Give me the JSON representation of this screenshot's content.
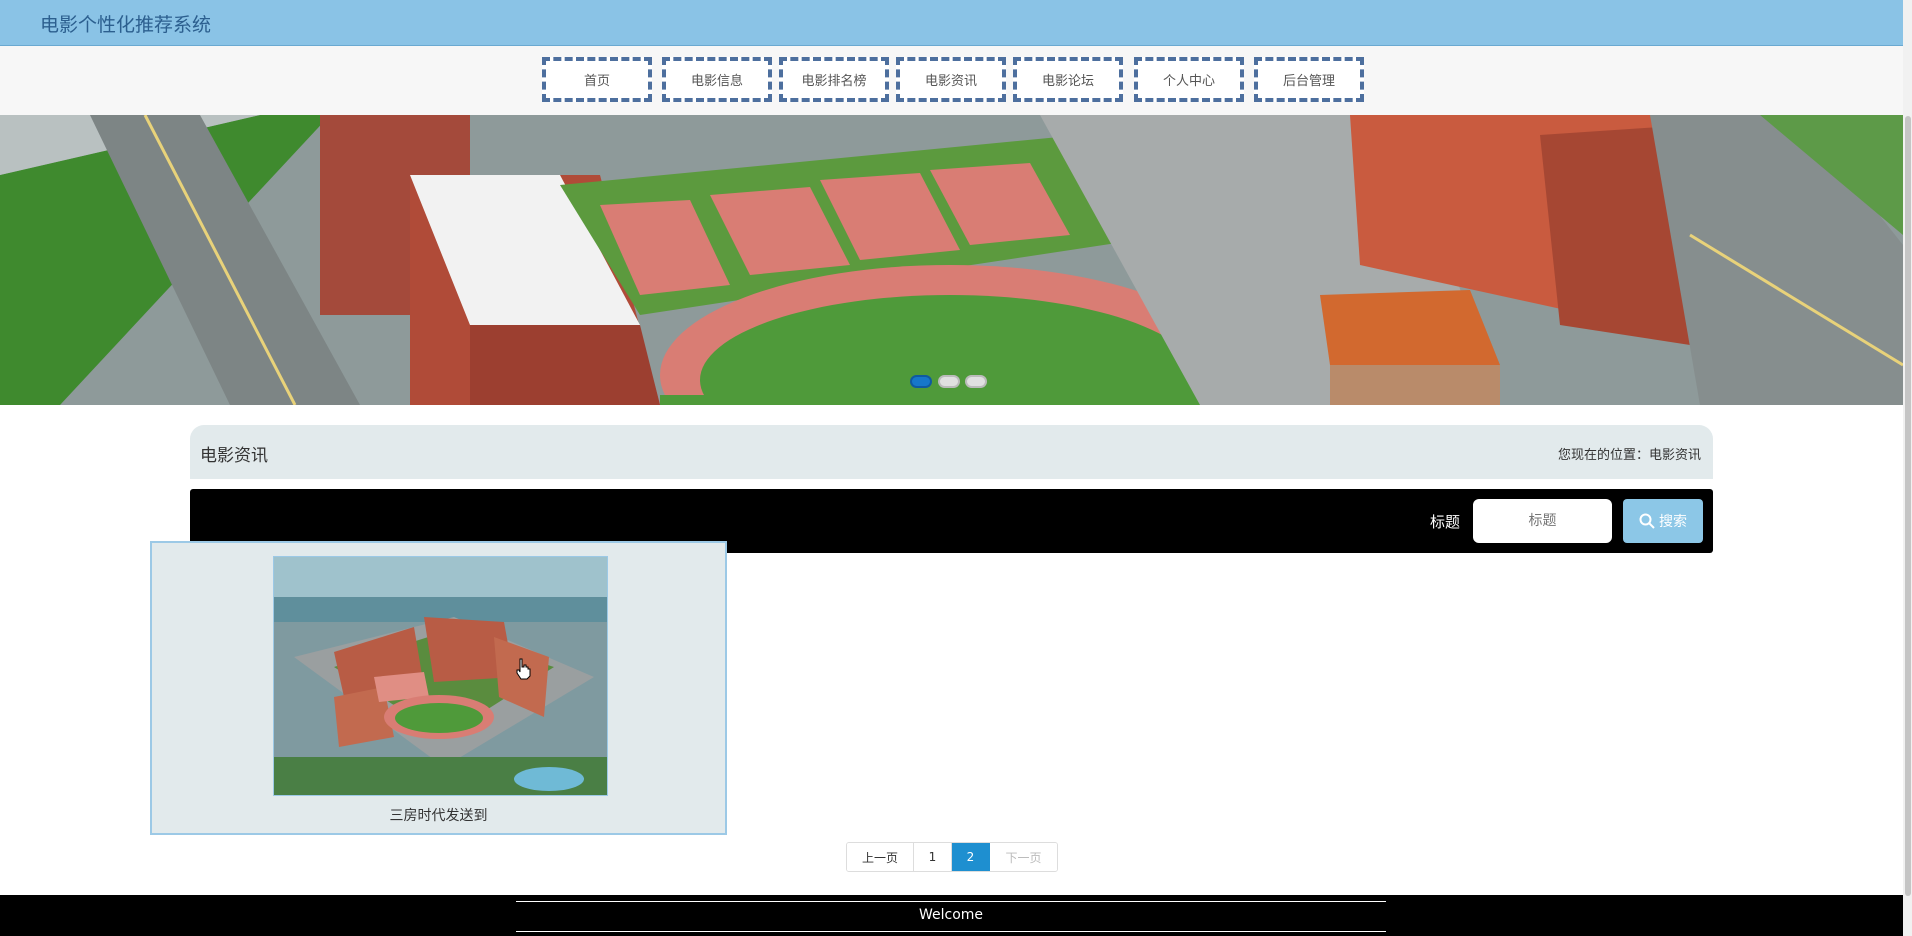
{
  "header": {
    "site_title": "电影个性化推荐系统"
  },
  "nav": {
    "items": [
      {
        "label": "首页"
      },
      {
        "label": "电影信息"
      },
      {
        "label": "电影排名榜"
      },
      {
        "label": "电影资讯"
      },
      {
        "label": "电影论坛"
      },
      {
        "label": "个人中心"
      },
      {
        "label": "后台管理"
      }
    ]
  },
  "banner": {
    "slide_count": 3,
    "active_slide": 1
  },
  "section": {
    "title": "电影资讯",
    "breadcrumb": "您现在的位置：电影资讯"
  },
  "search": {
    "label": "标题",
    "placeholder": "标题",
    "button_label": "搜索",
    "button_icon": "search-icon"
  },
  "news_items": [
    {
      "title": "三房时代发送到"
    }
  ],
  "pagination": {
    "prev_label": "上一页",
    "pages": [
      "1",
      "2"
    ],
    "current_page": "2",
    "next_label": "下一页"
  },
  "footer": {
    "text": "Welcome"
  },
  "colors": {
    "topbar": "#8ac3e6",
    "nav_border": "#4d6f9e",
    "search_button": "#8cc7e7",
    "page_active": "#1e8fd0",
    "panel": "#e2eaec"
  }
}
